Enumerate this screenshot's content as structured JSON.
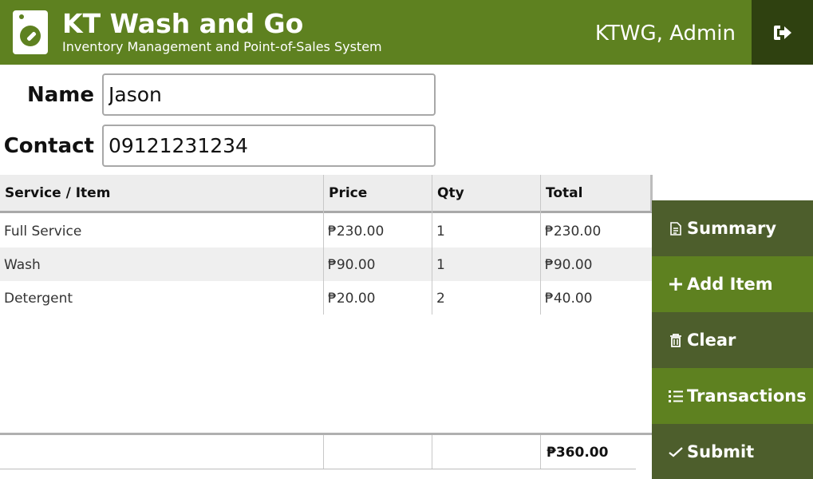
{
  "header": {
    "title": "KT Wash and Go",
    "subtitle": "Inventory Management and Point-of-Sales System",
    "user": "KTWG, Admin",
    "logo_icon": "washing-machine-icon",
    "logout_icon": "sign-out-icon"
  },
  "form": {
    "name_label": "Name",
    "name_value": "Jason",
    "contact_label": "Contact",
    "contact_value": "09121231234"
  },
  "table": {
    "columns": [
      "Service / Item",
      "Price",
      "Qty",
      "Total"
    ],
    "rows": [
      [
        "Full Service",
        "₱230.00",
        "1",
        "₱230.00"
      ],
      [
        "Wash",
        "₱90.00",
        "1",
        "₱90.00"
      ],
      [
        "Detergent",
        "₱20.00",
        "2",
        "₱40.00"
      ]
    ],
    "grand_total": "₱360.00"
  },
  "actions": [
    {
      "label": "Summary",
      "icon": "document-icon"
    },
    {
      "label": "Add Item",
      "icon": "plus-icon"
    },
    {
      "label": "Clear",
      "icon": "trash-icon"
    },
    {
      "label": "Transactions",
      "icon": "list-icon"
    },
    {
      "label": "Submit",
      "icon": "check-icon"
    }
  ],
  "colors": {
    "primary": "#5e8120",
    "primary_dark": "#4d5e2c",
    "logout_bg": "#2f4110"
  }
}
